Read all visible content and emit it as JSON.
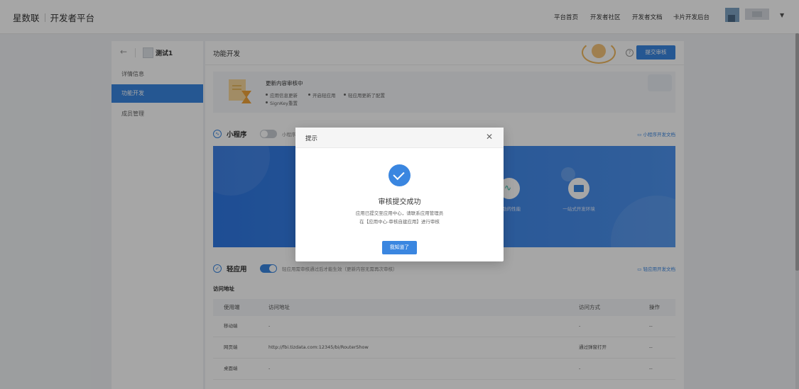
{
  "header": {
    "brand": "星数联",
    "platform": "开发者平台",
    "nav": [
      "平台首页",
      "开发者社区",
      "开发者文档",
      "卡片开发后台"
    ]
  },
  "sidebar": {
    "app_name": "测试1",
    "items": [
      {
        "label": "详情信息",
        "active": false
      },
      {
        "label": "功能开发",
        "active": true
      },
      {
        "label": "成员管理",
        "active": false
      }
    ]
  },
  "main": {
    "title": "功能开发",
    "submit_label": "提交审核",
    "notice": {
      "title": "更新内容审核中",
      "items": [
        "应用信息更新",
        "开启轻应用",
        "轻应用更新了配置",
        "SignKey重置"
      ]
    },
    "mini_program": {
      "title": "小程序",
      "enabled": false,
      "description": "小程序开",
      "doc_link": "小程序开发文档",
      "features": [
        {
          "label": "强劲的性能",
          "icon": "pulse-icon"
        },
        {
          "label": "一站式开发环境",
          "icon": "code-window-icon"
        }
      ]
    },
    "light_app": {
      "title": "轻应用",
      "enabled": true,
      "description": "轻应用需审核通过后才能生效（更新内容无需再次审核）",
      "doc_link": "轻应用开发文档",
      "access_title": "访问地址",
      "columns": [
        "使用端",
        "访问地址",
        "访问方式",
        "操作"
      ],
      "rows": [
        {
          "client": "移动端",
          "url": "-",
          "method": "-",
          "action": "--"
        },
        {
          "client": "网页端",
          "url": "http://fbi.tizdata.com:12345/bi/RouterShow",
          "method": "通过弹窗打开",
          "action": "--"
        },
        {
          "client": "桌面端",
          "url": "-",
          "method": "-",
          "action": "--"
        }
      ]
    }
  },
  "modal": {
    "title": "提示",
    "heading": "审核提交成功",
    "message_line1": "应用已提交至应用中心，请联系应用管理员",
    "message_line2": "在【应用中心-审核自建应用】进行审核",
    "ok_label": "我知道了"
  },
  "colors": {
    "accent": "#3a86e0",
    "overlay": "rgba(0,0,0,0.35)"
  }
}
